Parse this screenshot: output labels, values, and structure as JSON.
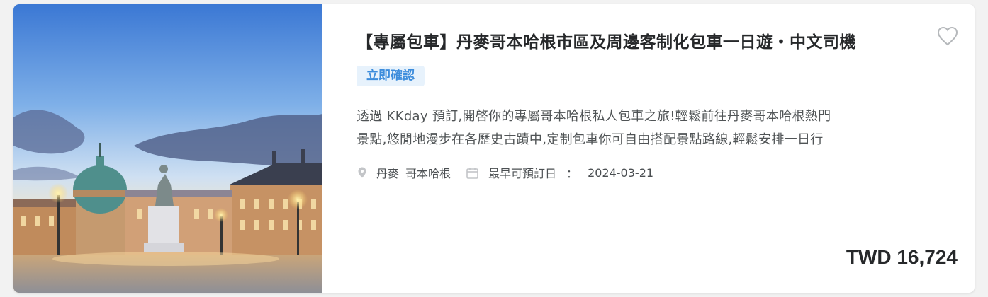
{
  "product": {
    "title": "【專屬包車】丹麥哥本哈根市區及周邊客制化包車一日遊・中文司機",
    "badge": "立即確認",
    "description_lines": [
      "透過 KKday 預訂,開啓你的專屬哥本哈根私人包車之旅!輕鬆前往丹麥哥本哈根熱門",
      "景點,悠閒地漫步在各歷史古蹟中,定制包車你可自由搭配景點路線,輕鬆安排一日行"
    ],
    "location": {
      "country": "丹麥",
      "city": "哥本哈根"
    },
    "earliest_date": {
      "label": "最早可預訂日",
      "separator": "：",
      "value": "2024-03-21"
    },
    "price": "TWD 16,724",
    "icons": {
      "favorite": "heart-outline-icon",
      "location": "map-pin-icon",
      "date": "calendar-icon"
    },
    "colors": {
      "badge_bg": "#e7f2fc",
      "badge_text": "#3d8ddc",
      "title": "#26282a"
    }
  }
}
